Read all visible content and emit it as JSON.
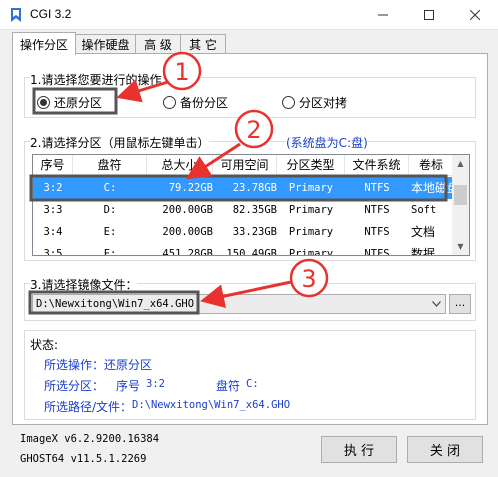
{
  "window": {
    "title": "CGI 3.2",
    "icon": "cgi-app-icon"
  },
  "tabs": [
    {
      "label": "操作分区",
      "active": true
    },
    {
      "label": "操作硬盘",
      "active": false
    },
    {
      "label": "高 级",
      "active": false
    },
    {
      "label": "其 它",
      "active": false
    }
  ],
  "operation": {
    "label": "1.请选择您要进行的操作：",
    "options": [
      {
        "label": "还原分区",
        "selected": true
      },
      {
        "label": "备份分区",
        "selected": false
      },
      {
        "label": "分区对拷",
        "selected": false
      }
    ]
  },
  "partition": {
    "label": "2.请选择分区（用鼠标左键单击）",
    "system_note": "(系统盘为C:盘)",
    "columns": [
      "序号",
      "盘符",
      "总大小",
      "可用空间",
      "分区类型",
      "文件系统",
      "卷标"
    ],
    "rows": [
      {
        "num": "3:2",
        "drive": "C:",
        "size": "79.22GB",
        "free": "23.78GB",
        "type": "Primary",
        "fs": "NTFS",
        "label": "本地磁盘",
        "selected": true
      },
      {
        "num": "3:3",
        "drive": "D:",
        "size": "200.00GB",
        "free": "82.35GB",
        "type": "Primary",
        "fs": "NTFS",
        "label": "Soft",
        "selected": false
      },
      {
        "num": "3:4",
        "drive": "E:",
        "size": "200.00GB",
        "free": "33.23GB",
        "type": "Primary",
        "fs": "NTFS",
        "label": "文档",
        "selected": false
      },
      {
        "num": "3:5",
        "drive": "F:",
        "size": "451.28GB",
        "free": "150.49GB",
        "type": "Primary",
        "fs": "NTFS",
        "label": "数据",
        "selected": false
      }
    ]
  },
  "image_file": {
    "label": "3.请选择镜像文件：",
    "value": "D:\\Newxitong\\Win7_x64.GHO",
    "browse_label": "..."
  },
  "status": {
    "heading": "状态:",
    "op_label": "所选操作：",
    "op_value": "还原分区",
    "part_label": "所选分区：",
    "part_num_label": "序号",
    "part_num": "3:2",
    "part_drive_label": "盘符",
    "part_drive": "C:",
    "path_label": "所选路径/文件：",
    "path_value": "D:\\Newxitong\\Win7_x64.GHO"
  },
  "footer": {
    "imagex": "ImageX v6.2.9200.16384",
    "ghost": "GHOST64 v11.5.1.2269",
    "execute_label": "执 行",
    "close_label": "关 闭"
  },
  "annotations": {
    "one": "1",
    "two": "2",
    "three": "3",
    "color": "#e8322d"
  }
}
